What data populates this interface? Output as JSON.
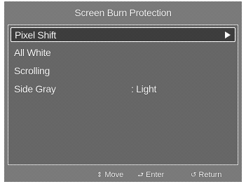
{
  "title": "Screen Burn Protection",
  "menu": {
    "items": [
      {
        "label": "Pixel Shift",
        "value": "",
        "selected": true,
        "has_submenu": true
      },
      {
        "label": "All White",
        "value": "",
        "selected": false,
        "has_submenu": false
      },
      {
        "label": "Scrolling",
        "value": "",
        "selected": false,
        "has_submenu": false
      },
      {
        "label": "Side Gray",
        "value": ": Light",
        "selected": false,
        "has_submenu": false
      }
    ]
  },
  "footer": {
    "move_label": "Move",
    "enter_label": "Enter",
    "return_label": "Return",
    "move_icon": "updown-arrows-icon",
    "enter_icon": "enter-icon",
    "return_icon": "return-icon"
  }
}
